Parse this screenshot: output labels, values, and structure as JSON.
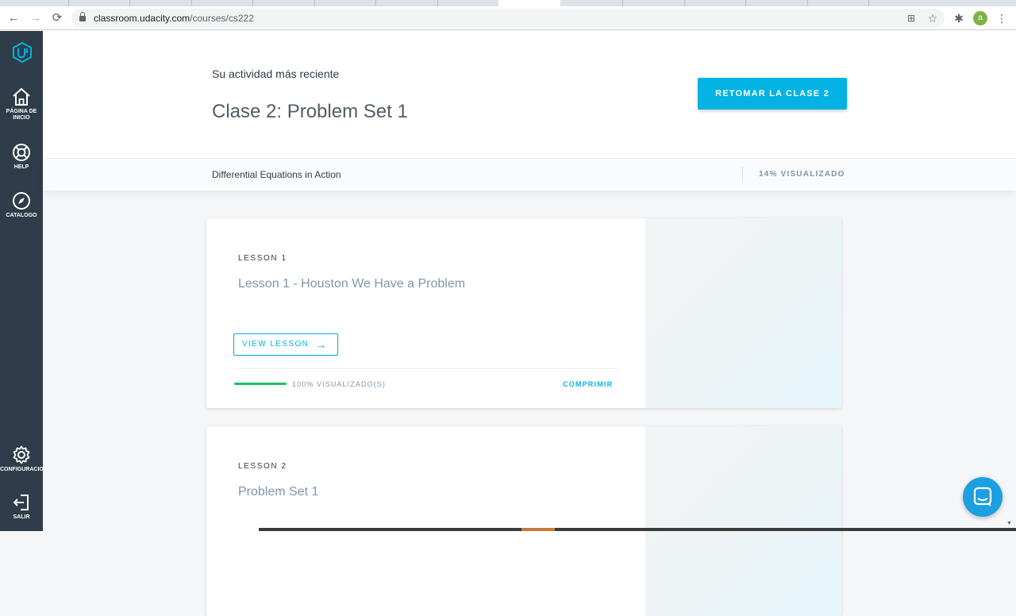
{
  "browser": {
    "url_host": "classroom.udacity.com",
    "url_path": "/courses/cs222",
    "profile_initial": "a"
  },
  "sidebar": {
    "items": [
      {
        "icon": "home-icon",
        "label": "PÁGINA DE INICIO"
      },
      {
        "icon": "help-icon",
        "label": "HELP"
      },
      {
        "icon": "compass-icon",
        "label": "CATALOGO"
      },
      {
        "icon": "gear-icon",
        "label": "CONFIGURACION"
      },
      {
        "icon": "logout-icon",
        "label": "SALIR"
      }
    ]
  },
  "header": {
    "recent_label": "Su actividad más reciente",
    "recent_title": "Clase 2: Problem Set 1",
    "resume_button": "RETOMAR LA CLASE 2"
  },
  "course": {
    "name": "Differential Equations in Action",
    "progress": "14% VISUALIZADO"
  },
  "lessons": [
    {
      "number": "LESSON 1",
      "title": "Lesson 1 - Houston We Have a Problem",
      "view_label": "VIEW LESSON",
      "progress_fraction": 1.0,
      "progress_text": "100% VISUALIZADO(S)",
      "collapse_label": "COMPRIMIR"
    },
    {
      "number": "LESSON 2",
      "title": "Problem Set 1"
    }
  ],
  "colors": {
    "sidebar": "#2e3d49",
    "accent": "#02b3e4",
    "progress": "#15c26b"
  }
}
